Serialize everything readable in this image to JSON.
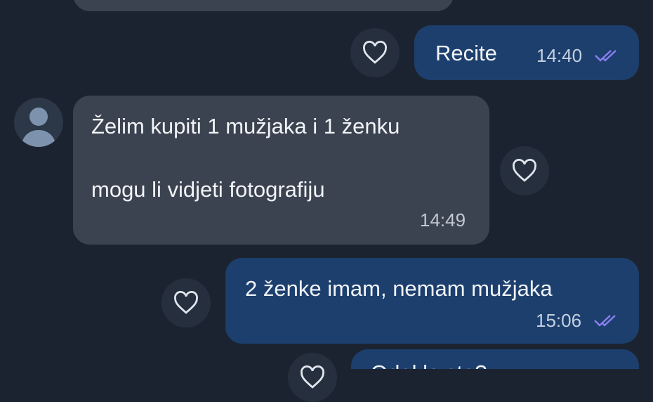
{
  "colors": {
    "background": "#1c2330",
    "incoming_bubble": "#3b4350",
    "outgoing_bubble": "#1c3f6e",
    "read_ticks": "#8a7ff0",
    "reaction_button": "#262f3d"
  },
  "messages": [
    {
      "direction": "incoming",
      "text": ""
    },
    {
      "direction": "outgoing",
      "text": "Recite",
      "time": "14:40",
      "status": "read",
      "reaction_icon": "heart-icon"
    },
    {
      "direction": "incoming",
      "sender_avatar": "user-avatar-icon",
      "line1": "Želim kupiti 1 mužjaka i 1 ženku",
      "line2": "mogu li vidjeti fotografiju",
      "time": "14:49",
      "reaction_icon": "heart-icon"
    },
    {
      "direction": "outgoing",
      "text": "2 ženke imam, nemam mužjaka",
      "time": "15:06",
      "status": "read",
      "reaction_icon": "heart-icon"
    },
    {
      "direction": "outgoing",
      "text": "Odakle ste?",
      "reaction_icon": "heart-icon"
    }
  ]
}
